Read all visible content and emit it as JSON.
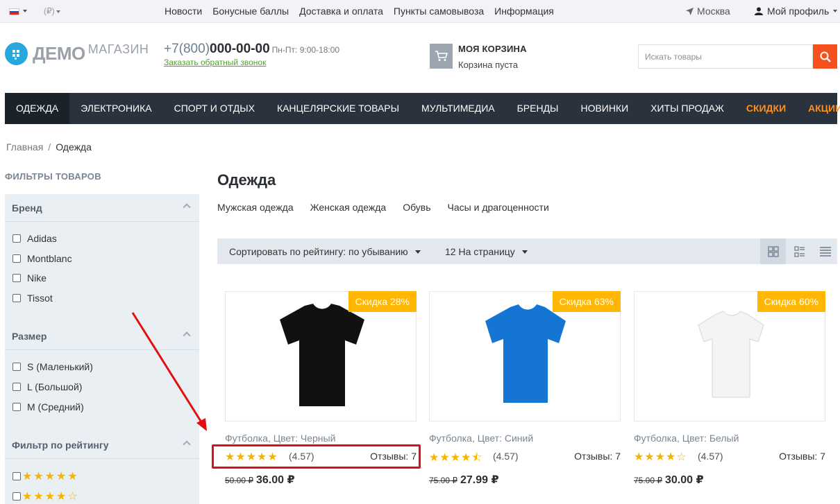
{
  "topbar": {
    "flag_colors": [
      "#ffffff",
      "#1c57b5",
      "#d52b1e"
    ],
    "currency": "(₽)",
    "links": [
      "Новости",
      "Бонусные баллы",
      "Доставка и оплата",
      "Пункты самовывоза",
      "Информация"
    ],
    "city": "Москва",
    "profile": "Мой профиль"
  },
  "header": {
    "logo_main": "ДЕМО",
    "logo_sub": "МАГАЗИН",
    "phone_prefix": "+7(800)",
    "phone_number": "000-00-00",
    "hours": "Пн-Пт: 9:00-18:00",
    "callback": "Заказать обратный звонок",
    "cart_title": "МОЯ КОРЗИНА",
    "cart_status": "Корзина пуста",
    "search_placeholder": "Искать товары"
  },
  "mainnav": [
    "Одежда",
    "Электроника",
    "Спорт и отдых",
    "Канцелярские товары",
    "Мультимедиа",
    "Бренды",
    "Новинки",
    "Хиты продаж",
    "Скидки",
    "Акции"
  ],
  "breadcrumb": {
    "home": "Главная",
    "sep": "/",
    "current": "Одежда"
  },
  "sidebar": {
    "title": "ФИЛЬТРЫ ТОВАРОВ",
    "brand": {
      "title": "Бренд",
      "options": [
        "Adidas",
        "Montblanc",
        "Nike",
        "Tissot"
      ]
    },
    "size": {
      "title": "Размер",
      "options": [
        "S (Маленький)",
        "L (Большой)",
        "M (Средний)"
      ]
    },
    "rating": {
      "title": "Фильтр по рейтингу",
      "options": [
        "★★★★★",
        "★★★★☆"
      ]
    }
  },
  "content": {
    "title": "Одежда",
    "subcategories": [
      "Мужская одежда",
      "Женская одежда",
      "Обувь",
      "Часы и драгоценности"
    ],
    "sort_label": "Сортировать по рейтингу: по убыванию",
    "per_page": "12 На страницу"
  },
  "products": [
    {
      "badge": "Скидка 28%",
      "name": "Футболка, Цвет: Черный",
      "stars": "★★★★★",
      "rating": "(4.57)",
      "reviews": "Отзывы: 7",
      "old_price": "50.00 ₽",
      "price": "36.00 ₽",
      "color": "#111111"
    },
    {
      "badge": "Скидка 63%",
      "name": "Футболка, Цвет: Синий",
      "stars": "★★★★⯪",
      "rating": "(4.57)",
      "reviews": "Отзывы: 7",
      "old_price": "75.00 ₽",
      "price": "27.99 ₽",
      "color": "#1476d2"
    },
    {
      "badge": "Скидка 60%",
      "name": "Футболка, Цвет: Белый",
      "stars": "★★★★☆",
      "rating": "(4.57)",
      "reviews": "Отзывы: 7",
      "old_price": "75.00 ₽",
      "price": "30.00 ₽",
      "color": "#f4f4f4"
    }
  ],
  "colors": {
    "accent": "#f4511e",
    "nav_bg": "#2a323d",
    "badge": "#ffb703",
    "star": "#f6b400",
    "annotation": "#e01010"
  }
}
